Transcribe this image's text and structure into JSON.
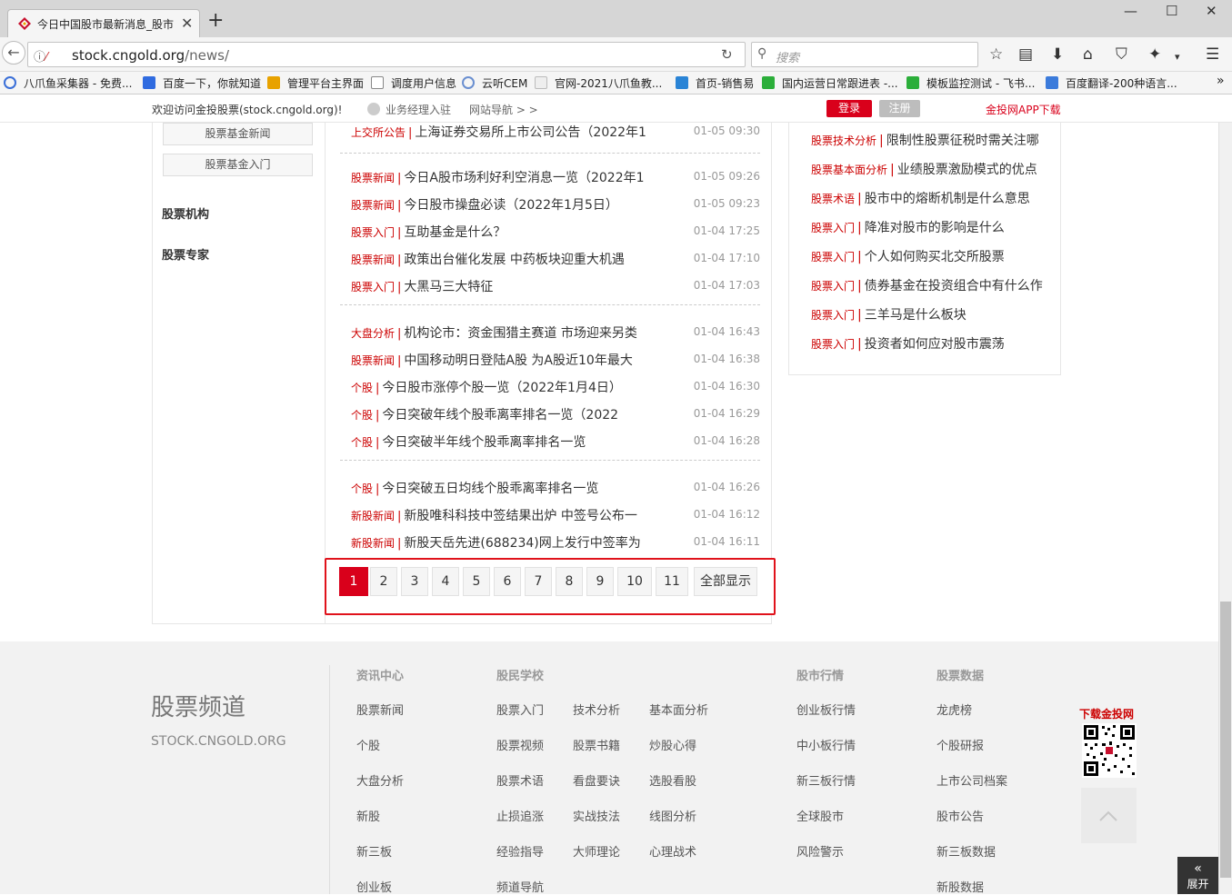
{
  "browser": {
    "tab_title": "今日中国股市最新消息_股市",
    "url_host": "stock.cngold.org",
    "url_path": "/news/",
    "search_placeholder": "搜索",
    "bookmarks": [
      "八爪鱼采集器 - 免费...",
      "百度一下，你就知道",
      "管理平台主界面",
      "调度用户信息",
      "云听CEM",
      "官网-2021八爪鱼教...",
      "首页-销售易",
      "国内运营日常跟进表 -...",
      "模板监控测试 - 飞书...",
      "百度翻译-200种语言..."
    ]
  },
  "topbar": {
    "welcome": "欢迎访问金投股票(stock.cngold.org)!",
    "manager": "业务经理入驻",
    "site_nav": "网站导航 > >",
    "login": "登录",
    "register": "注册",
    "app_download": "金投网APP下载"
  },
  "left": {
    "btn_fund_news": "股票基金新闻",
    "btn_fund_intro": "股票基金入门",
    "head_institutions": "股票机构",
    "head_experts": "股票专家"
  },
  "news": [
    {
      "cat": "上交所公告",
      "title": "上海证券交易所上市公司公告（2022年1",
      "time": "01-05 09:30"
    },
    {
      "cat": "股票新闻",
      "title": "今日A股市场利好利空消息一览（2022年1",
      "time": "01-05 09:26"
    },
    {
      "cat": "股票新闻",
      "title": "今日股市操盘必读（2022年1月5日）",
      "time": "01-05 09:23"
    },
    {
      "cat": "股票入门",
      "title": "互助基金是什么？",
      "time": "01-04 17:25"
    },
    {
      "cat": "股票新闻",
      "title": "政策出台催化发展 中药板块迎重大机遇",
      "time": "01-04 17:10"
    },
    {
      "cat": "股票入门",
      "title": "大黑马三大特征",
      "time": "01-04 17:03"
    },
    {
      "cat": "大盘分析",
      "title": "机构论市：资金围猎主赛道 市场迎来另类",
      "time": "01-04 16:43"
    },
    {
      "cat": "股票新闻",
      "title": "中国移动明日登陆A股 为A股近10年最大",
      "time": "01-04 16:38"
    },
    {
      "cat": "个股",
      "title": "今日股市涨停个股一览（2022年1月4日）",
      "time": "01-04 16:30"
    },
    {
      "cat": "个股",
      "title": "今日突破年线个股乖离率排名一览（2022",
      "time": "01-04 16:29"
    },
    {
      "cat": "个股",
      "title": "今日突破半年线个股乖离率排名一览",
      "time": "01-04 16:28"
    },
    {
      "cat": "个股",
      "title": "今日突破五日均线个股乖离率排名一览",
      "time": "01-04 16:26"
    },
    {
      "cat": "新股新闻",
      "title": "新股唯科科技中签结果出炉 中签号公布一",
      "time": "01-04 16:12"
    },
    {
      "cat": "新股新闻",
      "title": "新股天岳先进(688234)网上发行中签率为",
      "time": "01-04 16:11"
    }
  ],
  "pagination": {
    "pages": [
      "1",
      "2",
      "3",
      "4",
      "5",
      "6",
      "7",
      "8",
      "9",
      "10",
      "11"
    ],
    "current": "1",
    "show_all": "全部显示"
  },
  "right_list": [
    {
      "cat": "股票技术分析",
      "title": "限制性股票征税时需关注哪"
    },
    {
      "cat": "股票基本面分析",
      "title": "业绩股票激励模式的优点"
    },
    {
      "cat": "股票术语",
      "title": "股市中的熔断机制是什么意思"
    },
    {
      "cat": "股票入门",
      "title": "降准对股市的影响是什么"
    },
    {
      "cat": "股票入门",
      "title": "个人如何购买北交所股票"
    },
    {
      "cat": "股票入门",
      "title": "债券基金在投资组合中有什么作"
    },
    {
      "cat": "股票入门",
      "title": "三羊马是什么板块"
    },
    {
      "cat": "股票入门",
      "title": "投资者如何应对股市震荡"
    }
  ],
  "footer": {
    "brand": "股票频道",
    "domain": "STOCK.CNGOLD.ORG",
    "col_info": {
      "head": "资讯中心",
      "links": [
        "股票新闻",
        "个股",
        "大盘分析",
        "新股",
        "新三板",
        "创业板"
      ]
    },
    "col_school": {
      "head": "股民学校",
      "links": [
        [
          "股票入门",
          "技术分析",
          "基本面分析"
        ],
        [
          "股票视频",
          "股票书籍",
          "炒股心得"
        ],
        [
          "股票术语",
          "看盘要诀",
          "选股看股"
        ],
        [
          "止损追涨",
          "实战技法",
          "线图分析"
        ],
        [
          "经验指导",
          "大师理论",
          "心理战术"
        ],
        [
          "频道导航"
        ]
      ]
    },
    "col_market": {
      "head": "股市行情",
      "links": [
        "创业板行情",
        "中小板行情",
        "新三板行情",
        "全球股市",
        "风险警示"
      ]
    },
    "col_data": {
      "head": "股票数据",
      "links": [
        "龙虎榜",
        "个股研报",
        "上市公司档案",
        "股市公告",
        "新三板数据",
        "新股数据"
      ]
    },
    "download": "下载金投网",
    "expand": "展开"
  },
  "colors": {
    "brand_red": "#d9001b",
    "highlight_border": "#e0121b"
  },
  "icons": [
    "back-arrow-icon",
    "info-icon",
    "reload-icon",
    "search-icon",
    "star-icon",
    "reading-list-icon",
    "download-icon",
    "home-icon",
    "pocket-icon",
    "extension-icon",
    "menu-icon",
    "close-icon",
    "scroll-top-icon",
    "user-icon",
    "qr-code-icon"
  ]
}
